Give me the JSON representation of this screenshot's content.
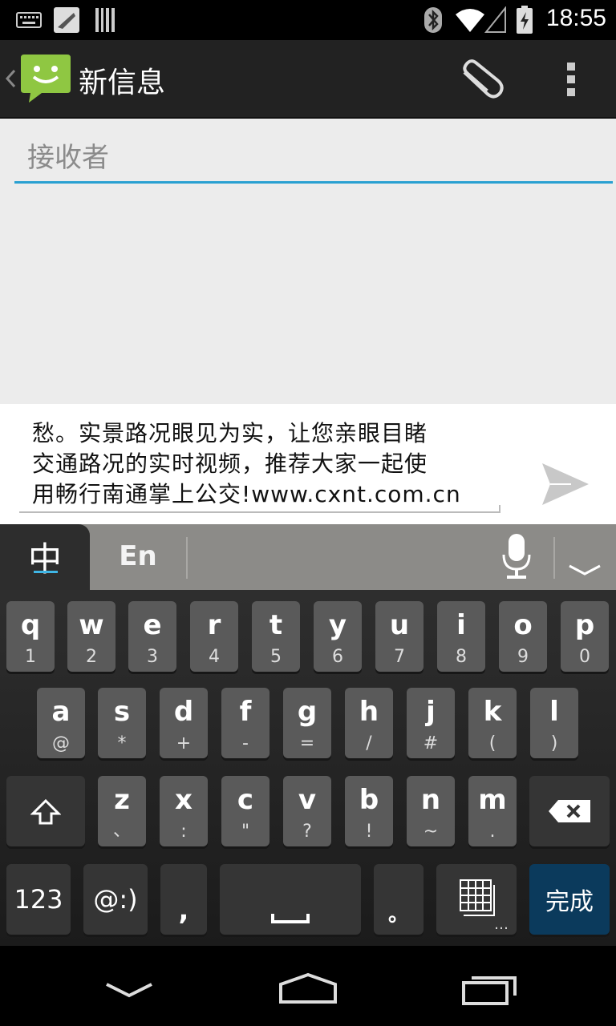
{
  "status_bar": {
    "time": "18:55"
  },
  "action_bar": {
    "title": "新信息"
  },
  "recipient": {
    "placeholder": "接收者"
  },
  "compose": {
    "lines": [
      "愁。实景路况眼见为实，让您亲眼目睹",
      "交通路况的实时视频，推荐大家一起使",
      "用畅行南通掌上公交!www.cxnt.com.cn"
    ]
  },
  "ime": {
    "tab_zh": "中",
    "tab_en": "En"
  },
  "keyboard": {
    "row1": [
      {
        "k": "q",
        "s": "1"
      },
      {
        "k": "w",
        "s": "2"
      },
      {
        "k": "e",
        "s": "3"
      },
      {
        "k": "r",
        "s": "4"
      },
      {
        "k": "t",
        "s": "5"
      },
      {
        "k": "y",
        "s": "6"
      },
      {
        "k": "u",
        "s": "7"
      },
      {
        "k": "i",
        "s": "8"
      },
      {
        "k": "o",
        "s": "9"
      },
      {
        "k": "p",
        "s": "0"
      }
    ],
    "row2": [
      {
        "k": "a",
        "s": "@"
      },
      {
        "k": "s",
        "s": "*"
      },
      {
        "k": "d",
        "s": "+"
      },
      {
        "k": "f",
        "s": "-"
      },
      {
        "k": "g",
        "s": "="
      },
      {
        "k": "h",
        "s": "/"
      },
      {
        "k": "j",
        "s": "#"
      },
      {
        "k": "k",
        "s": "("
      },
      {
        "k": "l",
        "s": ")"
      }
    ],
    "row3": [
      {
        "k": "z",
        "s": "、"
      },
      {
        "k": "x",
        "s": ":"
      },
      {
        "k": "c",
        "s": "\""
      },
      {
        "k": "v",
        "s": "?"
      },
      {
        "k": "b",
        "s": "!"
      },
      {
        "k": "n",
        "s": "~"
      },
      {
        "k": "m",
        "s": "."
      }
    ],
    "key_123": "123",
    "key_emoji": "@:)",
    "key_comma": ",",
    "key_period": "。",
    "key_done": "完成"
  }
}
